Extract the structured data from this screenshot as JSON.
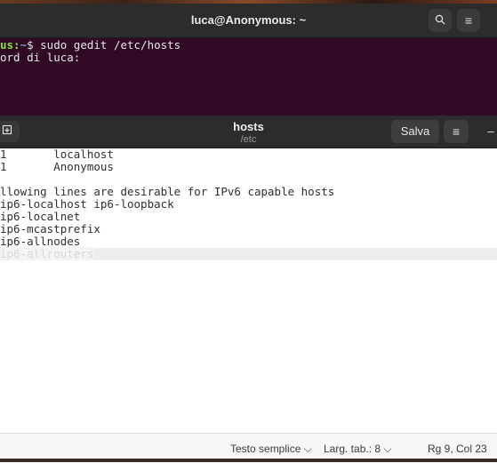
{
  "terminal": {
    "title": "luca@Anonymous: ~",
    "search_icon": "search-icon",
    "menu_icon": "hamburger-menu-icon",
    "lines": [
      {
        "user": "us:",
        "dir": "~",
        "rest": "$ sudo gedit /etc/hosts"
      },
      {
        "text": "ord di luca:"
      }
    ]
  },
  "gedit": {
    "filename": "hosts",
    "path": "/etc",
    "open_icon": "new-document-icon",
    "save_label": "Salva",
    "menu_icon": "hamburger-menu-icon",
    "minimize_label": "–",
    "lines": [
      "1       localhost",
      "1       Anonymous",
      "",
      "llowing lines are desirable for IPv6 capable hosts",
      "ip6-localhost ip6-loopback",
      "ip6-localnet",
      "ip6-mcastprefix",
      "ip6-allnodes",
      "ip6-allrouters"
    ],
    "status": {
      "language": "Testo semplice ⌵",
      "tab_width": "Larg. tab.: 8 ⌵",
      "position": "Rg 9, Col 23"
    }
  },
  "colors": {
    "terminal_bg": "#300a24",
    "header_bg": "#2c2c2c",
    "prompt_user": "#8ae234",
    "prompt_dir": "#729fcf"
  }
}
